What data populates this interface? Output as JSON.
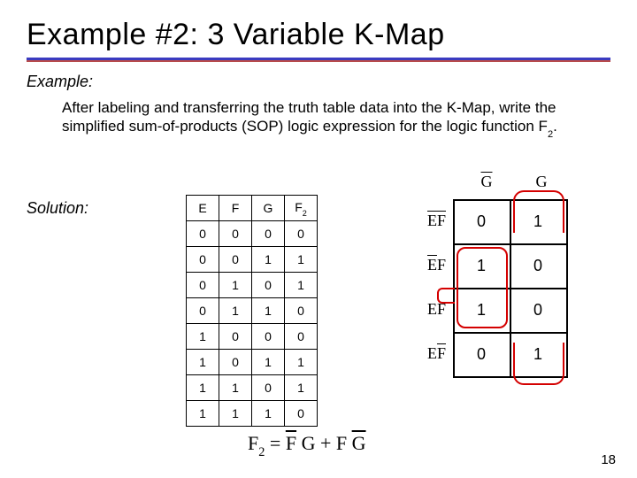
{
  "title": "Example #2: 3 Variable K-Map",
  "example_label": "Example:",
  "body_text_pre": "After labeling and transferring the truth table data into the K-Map, write the simplified sum-of-products (SOP) logic expression for the logic function F",
  "body_text_sub": "2",
  "body_text_post": ".",
  "solution_label": "Solution:",
  "truth_table": {
    "headers": [
      "E",
      "F",
      "G",
      "F2"
    ],
    "header_sub": "2",
    "rows": [
      [
        "0",
        "0",
        "0",
        "0"
      ],
      [
        "0",
        "0",
        "1",
        "1"
      ],
      [
        "0",
        "1",
        "0",
        "1"
      ],
      [
        "0",
        "1",
        "1",
        "0"
      ],
      [
        "1",
        "0",
        "0",
        "0"
      ],
      [
        "1",
        "0",
        "1",
        "1"
      ],
      [
        "1",
        "1",
        "0",
        "1"
      ],
      [
        "1",
        "1",
        "1",
        "0"
      ]
    ]
  },
  "kmap": {
    "col_labels": {
      "gbar": "G",
      "g": "G"
    },
    "row_labels": {
      "r0_e": "E",
      "r0_f": "F",
      "r1_e": "E",
      "r1_f": "F",
      "r2_e": "E",
      "r2_f": "F",
      "r3_e": "E",
      "r3_f": "F"
    },
    "cells": {
      "c00": "0",
      "c01": "1",
      "c10": "1",
      "c11": "0",
      "c20": "1",
      "c21": "0",
      "c30": "0",
      "c31": "1"
    }
  },
  "equation": {
    "lhs_var": "F",
    "lhs_sub": "2",
    "eq": " = ",
    "t1a": "F",
    "t1b": "G",
    "plus": " + ",
    "t2a": "F",
    "t2b": "G"
  },
  "page_num": "18"
}
